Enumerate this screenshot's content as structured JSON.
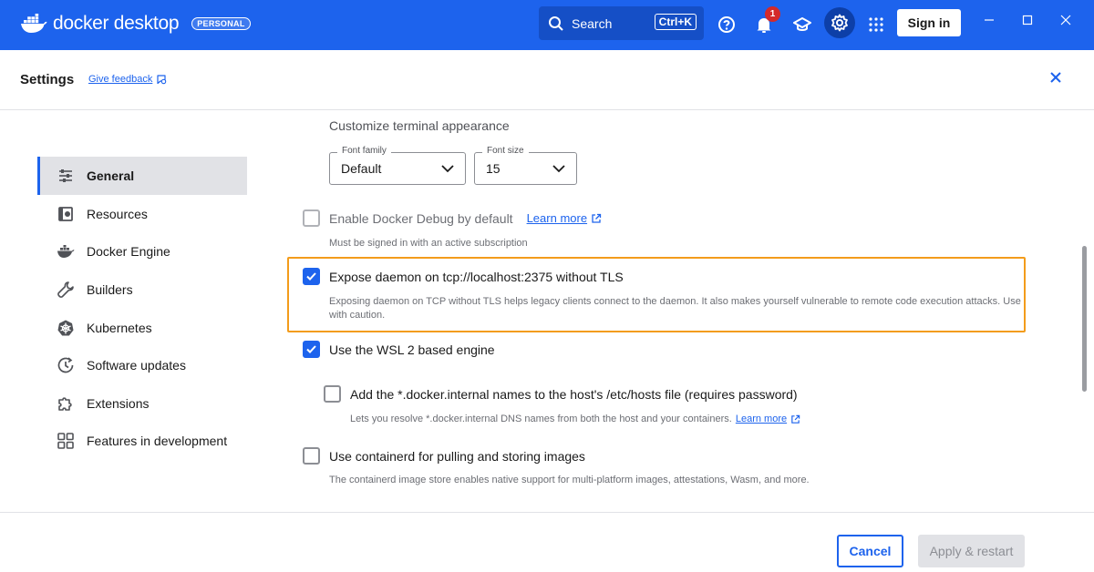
{
  "app": {
    "logo_text": "docker desktop",
    "plan_badge": "PERSONAL",
    "brand_color": "#1d63ed"
  },
  "topbar": {
    "search_label": "Search",
    "search_shortcut": "Ctrl+K",
    "notification_count": "1",
    "sign_in_label": "Sign in"
  },
  "header": {
    "title": "Settings",
    "feedback_link": "Give feedback"
  },
  "sidebar": {
    "items": [
      {
        "label": "General",
        "icon": "sliders-icon",
        "active": true
      },
      {
        "label": "Resources",
        "icon": "resources-icon"
      },
      {
        "label": "Docker Engine",
        "icon": "whale-icon"
      },
      {
        "label": "Builders",
        "icon": "wrench-icon"
      },
      {
        "label": "Kubernetes",
        "icon": "helm-icon"
      },
      {
        "label": "Software updates",
        "icon": "clock-update-icon"
      },
      {
        "label": "Extensions",
        "icon": "puzzle-icon"
      },
      {
        "label": "Features in development",
        "icon": "grid-icon"
      }
    ]
  },
  "content": {
    "terminal_section_title": "Customize terminal appearance",
    "font_family": {
      "label": "Font family",
      "value": "Default"
    },
    "font_size": {
      "label": "Font size",
      "value": "15"
    },
    "debug": {
      "label": "Enable Docker Debug by default",
      "link": "Learn more",
      "description": "Must be signed in with an active subscription",
      "checked": false
    },
    "expose_daemon": {
      "label": "Expose daemon on tcp://localhost:2375 without TLS",
      "description": "Exposing daemon on TCP without TLS helps legacy clients connect to the daemon. It also makes yourself vulnerable to remote code execution attacks. Use with caution.",
      "checked": true
    },
    "wsl2": {
      "label": "Use the WSL 2 based engine",
      "checked": true
    },
    "internal_names": {
      "label": "Add the *.docker.internal names to the host's /etc/hosts file (requires password)",
      "description": "Lets you resolve *.docker.internal DNS names from both the host and your containers.",
      "link": "Learn more",
      "checked": false
    },
    "containerd": {
      "label": "Use containerd for pulling and storing images",
      "description": "The containerd image store enables native support for multi-platform images, attestations, Wasm, and more.",
      "checked": false
    }
  },
  "footer": {
    "cancel_label": "Cancel",
    "apply_label": "Apply & restart"
  }
}
